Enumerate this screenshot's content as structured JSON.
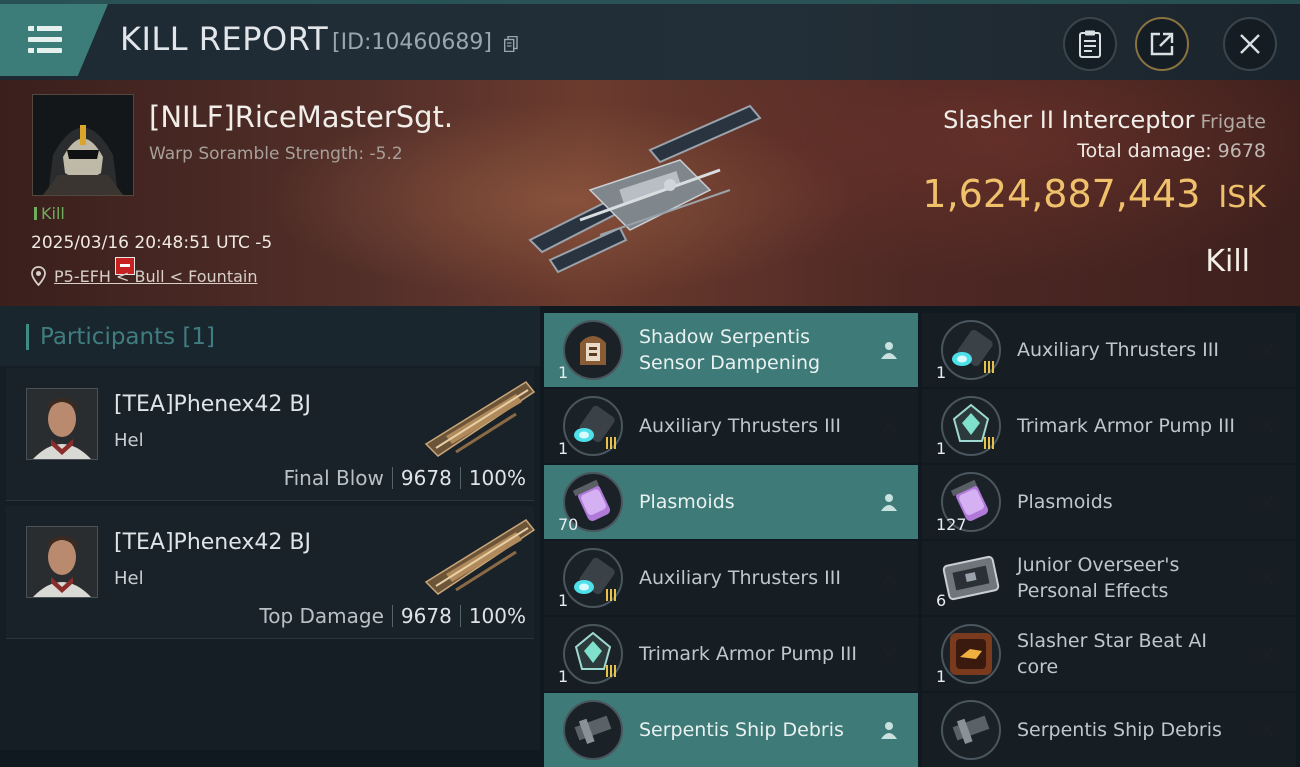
{
  "header": {
    "title": "KILL REPORT",
    "kill_id": "[ID:10460689]",
    "icons": [
      "menu-icon",
      "copy-icon",
      "clipboard-icon",
      "share-icon",
      "close-icon"
    ]
  },
  "victim": {
    "name": "[NILF]RiceMasterSgt.",
    "warp_scramble": "Warp Soramble Strength: -5.2",
    "kill_tag": "Kill",
    "datetime": "2025/03/16 20:48:51 UTC -5",
    "location": "P5-EFH < Bull < Fountain",
    "ship_name": "Slasher II Interceptor",
    "ship_class": "Frigate",
    "total_damage_label": "Total damage:",
    "total_damage": "9678",
    "isk_value": "1,624,887,443",
    "isk_unit": "ISK",
    "result": "Kill"
  },
  "participants": {
    "title": "Participants",
    "count": "[1]",
    "list": [
      {
        "name": "[TEA]Phenex42 BJ",
        "ship": "Hel",
        "role": "Final Blow",
        "damage": "9678",
        "percent": "100%"
      },
      {
        "name": "[TEA]Phenex42 BJ",
        "ship": "Hel",
        "role": "Top Damage",
        "damage": "9678",
        "percent": "100%"
      }
    ]
  },
  "items": [
    {
      "name": "Shadow Serpentis Sensor Dampening",
      "qty": "1",
      "status": "dropped",
      "icon": "sensor-dampening-icon"
    },
    {
      "name": "Auxiliary Thrusters III",
      "qty": "1",
      "status": "destroyed",
      "icon": "thruster-icon"
    },
    {
      "name": "Auxiliary Thrusters III",
      "qty": "1",
      "status": "destroyed",
      "icon": "thruster-icon"
    },
    {
      "name": "Trimark Armor Pump III",
      "qty": "1",
      "status": "destroyed",
      "icon": "armor-pump-icon"
    },
    {
      "name": "Plasmoids",
      "qty": "70",
      "status": "dropped",
      "icon": "plasmoid-icon"
    },
    {
      "name": "Plasmoids",
      "qty": "127",
      "status": "destroyed",
      "icon": "plasmoid-icon"
    },
    {
      "name": "Auxiliary Thrusters III",
      "qty": "1",
      "status": "destroyed",
      "icon": "thruster-icon"
    },
    {
      "name": "Junior Overseer's Personal Effects",
      "qty": "6",
      "status": "destroyed",
      "icon": "personal-effects-icon"
    },
    {
      "name": "Trimark Armor Pump III",
      "qty": "1",
      "status": "destroyed",
      "icon": "armor-pump-icon"
    },
    {
      "name": "Slasher Star Beat AI core",
      "qty": "1",
      "status": "destroyed",
      "icon": "ai-core-icon"
    },
    {
      "name": "Serpentis Ship Debris",
      "qty": "",
      "status": "dropped",
      "icon": "debris-icon"
    },
    {
      "name": "Serpentis Ship Debris",
      "qty": "",
      "status": "destroyed",
      "icon": "debris-icon"
    }
  ],
  "colors": {
    "accent": "#3e7a77",
    "isk": "#f0c16b",
    "kill_tag": "#6fae5e",
    "badge_red": "#c62222"
  }
}
